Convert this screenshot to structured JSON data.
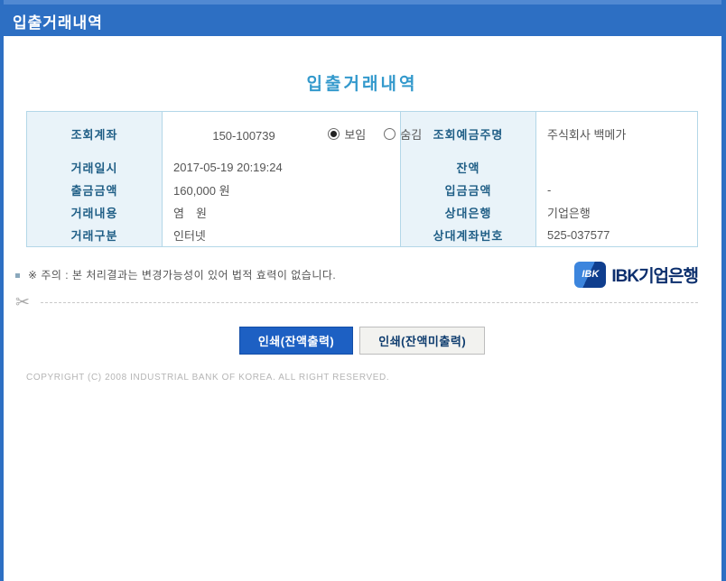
{
  "header": {
    "title": "입출거래내역"
  },
  "page": {
    "title": "입출거래내역"
  },
  "table": {
    "rows": [
      {
        "label_left": "조회계좌",
        "value_left": "150-100739",
        "label_right": "조회예금주명",
        "value_right": "주식회사 백메가"
      },
      {
        "label_left": "거래일시",
        "value_left": "2017-05-19 20:19:24",
        "label_right": "잔액",
        "value_right": ""
      },
      {
        "label_left": "출금금액",
        "value_left": "160,000 원",
        "label_right": "입금금액",
        "value_right": "-"
      },
      {
        "label_left": "거래내용",
        "value_left": "염　원",
        "label_right": "상대은행",
        "value_right": "기업은행"
      },
      {
        "label_left": "거래구분",
        "value_left": "인터넷",
        "label_right": "상대계좌번호",
        "value_right": "525-037577"
      }
    ],
    "account_visibility": {
      "options": [
        {
          "label": "보임",
          "selected": true
        },
        {
          "label": "숨김",
          "selected": false
        }
      ]
    }
  },
  "notice": {
    "text": "※ 주의 : 본 처리결과는 변경가능성이 있어 법적 효력이 없습니다."
  },
  "logo": {
    "mark": "IBK",
    "text": "IBK기업은행"
  },
  "buttons": {
    "print_with_balance": "인쇄(잔액출력)",
    "print_without_balance": "인쇄(잔액미출력)"
  },
  "footer": {
    "copyright": "COPYRIGHT (C) 2008 INDUSTRIAL BANK OF KOREA. ALL RIGHT RESERVED."
  },
  "icons": {
    "scissors": "✂"
  },
  "colors": {
    "header_blue": "#2d6fc3",
    "header_strip": "#5189d2",
    "title_teal": "#3399cc",
    "label_bg": "#e9f3f9",
    "label_text": "#1f5e86",
    "table_border": "#b3d7e8",
    "primary_button": "#1d60c3",
    "ibk_navy": "#0c2f6d"
  }
}
